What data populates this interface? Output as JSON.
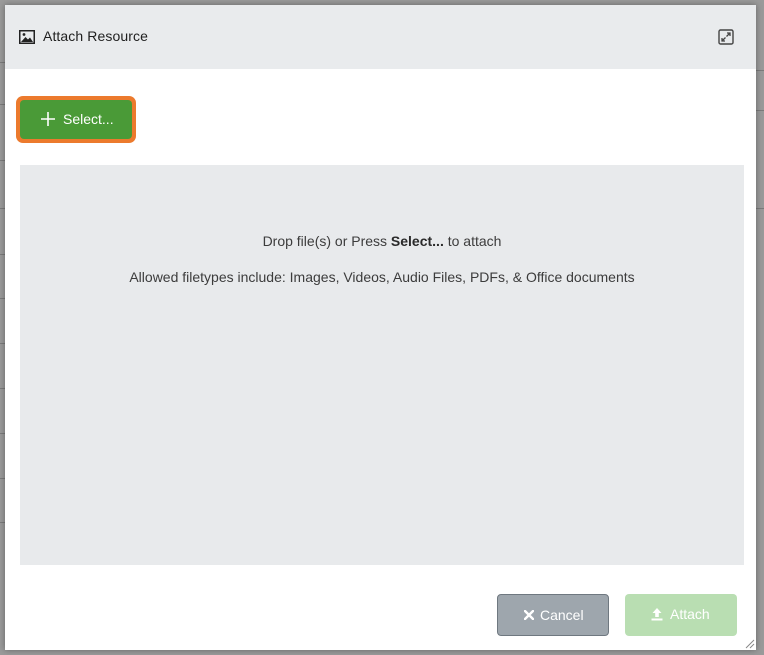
{
  "dialog": {
    "title": "Attach Resource",
    "title_icon": "image-icon",
    "expand_icon": "expand-icon"
  },
  "select_button": {
    "label": "Select...",
    "icon": "plus-icon"
  },
  "dropzone": {
    "prefix": "Drop file(s) or Press ",
    "bold": "Select...",
    "suffix": " to attach",
    "allowed": "Allowed filetypes include: Images, Videos, Audio Files, PDFs, & Office documents"
  },
  "footer": {
    "cancel_label": "Cancel",
    "cancel_icon": "close-icon",
    "attach_label": "Attach",
    "attach_icon": "upload-icon"
  },
  "colors": {
    "select_button": "#4a9a37",
    "select_highlight": "#ec7a2d",
    "cancel_button": "#9ea6ad",
    "attach_button_disabled": "#b9deb2",
    "titlebar": "#e9ebed",
    "dropzone": "#e8eaec"
  }
}
